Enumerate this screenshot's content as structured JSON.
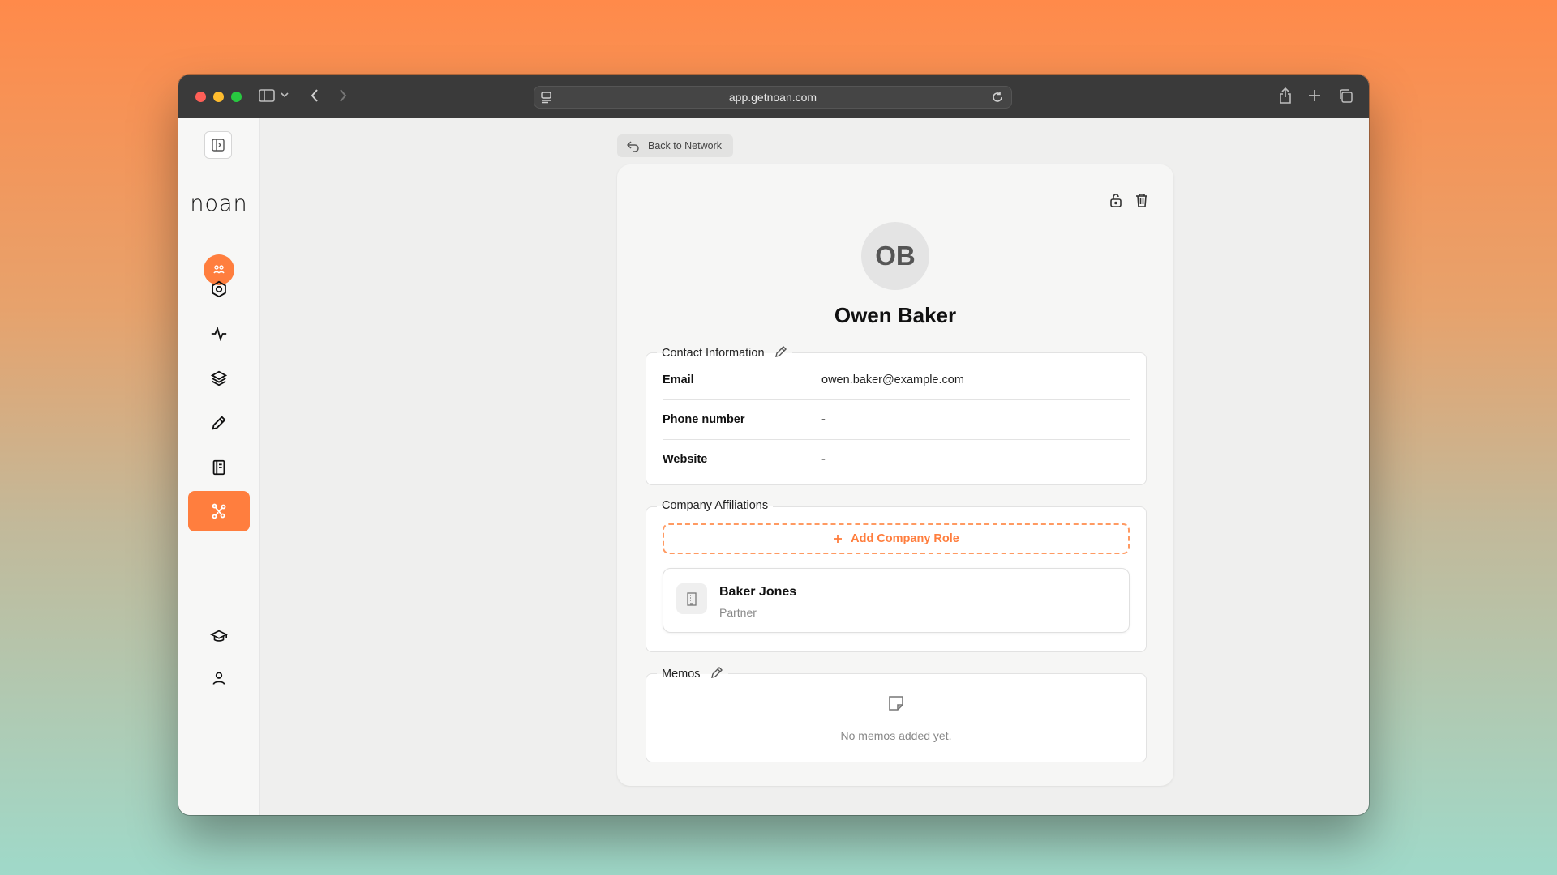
{
  "browser": {
    "url": "app.getnoan.com"
  },
  "sidebar": {
    "logo": "noan",
    "items": [
      {
        "icon": "hexagon-icon"
      },
      {
        "icon": "activity-icon"
      },
      {
        "icon": "layers-icon"
      },
      {
        "icon": "pencil-icon"
      },
      {
        "icon": "notebook-icon"
      },
      {
        "icon": "network-icon",
        "active": true
      }
    ],
    "bottom": [
      {
        "icon": "graduation-cap-icon"
      },
      {
        "icon": "user-icon"
      }
    ]
  },
  "header": {
    "back_label": "Back to Network"
  },
  "contact": {
    "initials": "OB",
    "name": "Owen Baker"
  },
  "contact_info": {
    "title": "Contact Information",
    "rows": [
      {
        "label": "Email",
        "value": "owen.baker@example.com"
      },
      {
        "label": "Phone number",
        "value": "-"
      },
      {
        "label": "Website",
        "value": "-"
      }
    ]
  },
  "affiliations": {
    "title": "Company Affiliations",
    "add_label": "Add Company Role",
    "companies": [
      {
        "name": "Baker Jones",
        "role": "Partner"
      }
    ]
  },
  "memos": {
    "title": "Memos",
    "empty_text": "No memos added yet."
  },
  "colors": {
    "accent": "#ff7e3e"
  }
}
